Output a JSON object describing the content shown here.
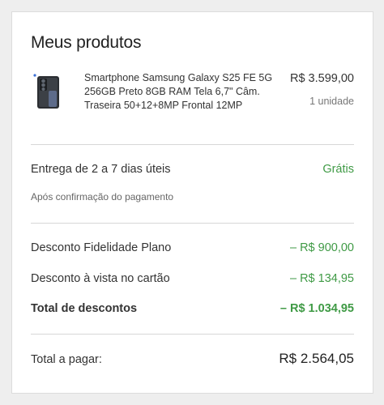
{
  "cart": {
    "title": "Meus produtos",
    "product": {
      "name": "Smartphone Samsung Galaxy S25 FE 5G 256GB Preto 8GB RAM Tela 6,7\" Câm. Traseira 50+12+8MP Frontal 12MP",
      "price": "R$ 3.599,00",
      "quantity": "1 unidade",
      "icon": "smartphone-image"
    },
    "delivery": {
      "label": "Entrega de 2 a 7 dias úteis",
      "value": "Grátis",
      "note": "Após confirmação do pagamento"
    },
    "discounts": {
      "fidelity_label": "Desconto Fidelidade Plano",
      "fidelity_value": "– R$ 900,00",
      "cash_label": "Desconto à vista no cartão",
      "cash_value": "– R$ 134,95",
      "total_label": "Total de descontos",
      "total_value": "– R$ 1.034,95"
    },
    "total": {
      "label": "Total a pagar:",
      "value": "R$ 2.564,05"
    }
  },
  "colors": {
    "accent_green": "#3f9a45",
    "text": "#333333",
    "divider": "#d7d7d7",
    "background": "#eeeeee"
  }
}
